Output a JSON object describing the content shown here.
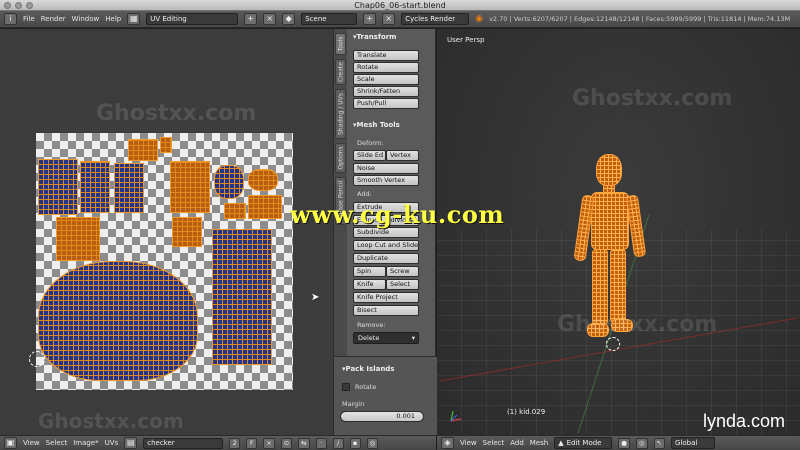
{
  "window": {
    "title": "Chap06_06-start.blend"
  },
  "topbar": {
    "menus": [
      "File",
      "Render",
      "Window",
      "Help"
    ],
    "screen_layout": "UV Editing",
    "scene": "Scene",
    "render_engine": "Cycles Render",
    "stats": "v2.70 | Verts:6207/6207 | Edges:12148/12148 | Faces:5999/5999 | Tris:11814 | Mem:74.13M"
  },
  "toolshelf": {
    "tabs": [
      "Tools",
      "Create",
      "Shading / UVs",
      "Options",
      "Grease Pencil"
    ],
    "transform": {
      "header": "Transform",
      "buttons": [
        "Translate",
        "Rotate",
        "Scale",
        "Shrink/Fatten",
        "Push/Pull"
      ]
    },
    "mesh_tools": {
      "header": "Mesh Tools",
      "deform_label": "Deform:",
      "slide_edge": "Slide Ed",
      "vertex": "Vertex",
      "noise": "Noise",
      "smooth_vertex": "Smooth Vertex",
      "add_label": "Add:",
      "extrude": "Extrude",
      "extrude_individual": "Extrude Individual",
      "subdivide": "Subdivide",
      "loop_cut": "Loop Cut and Slide",
      "duplicate": "Duplicate",
      "spin": "Spin",
      "screw": "Screw",
      "knife": "Knife",
      "select": "Select",
      "knife_project": "Knife Project",
      "bisect": "Bisect",
      "remove_label": "Remove:",
      "delete": "Delete"
    },
    "pack_islands": {
      "header": "Pack Islands",
      "rotate_label": "Rotate",
      "margin_label": "Margin",
      "margin_value": "0.001"
    }
  },
  "viewport": {
    "view_label": "User Persp",
    "object_label": "(1) kid.029"
  },
  "uv_footer": {
    "menus": [
      "View",
      "Select",
      "Image*",
      "UVs"
    ],
    "image_name": "checker",
    "users": "2",
    "fake_user": "F"
  },
  "viewport_footer": {
    "menus": [
      "View",
      "Select",
      "Add",
      "Mesh"
    ],
    "mode": "Edit Mode",
    "orientation": "Global"
  },
  "watermarks": {
    "site": "www.cg-ku.com",
    "ghost": "Ghostxx.com",
    "brand": "lynda.com"
  },
  "colors": {
    "uv_island_fill": "#23338a",
    "wire": "#f29a2e",
    "checker_dark": "#8c8c8c"
  }
}
